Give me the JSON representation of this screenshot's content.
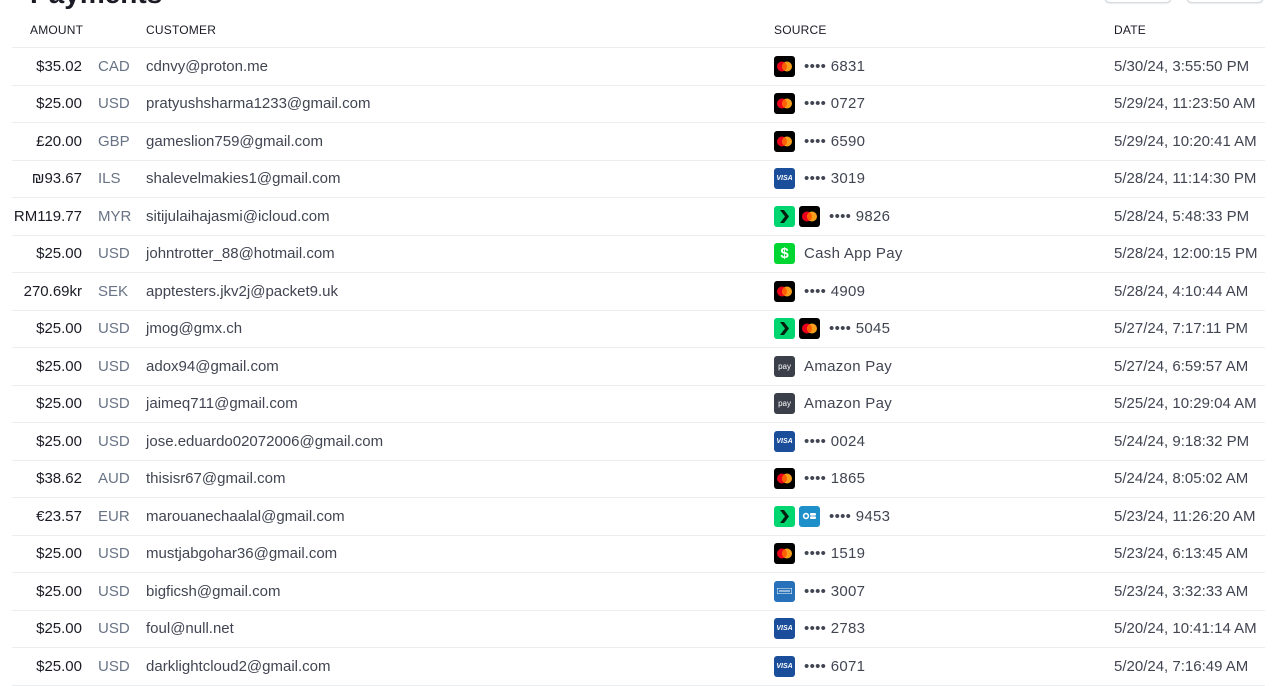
{
  "page": {
    "title": "Payments"
  },
  "table": {
    "columns": {
      "amount": "AMOUNT",
      "customer": "CUSTOMER",
      "source": "SOURCE",
      "date": "DATE"
    },
    "rows": [
      {
        "amount": "$35.02",
        "currency": "CAD",
        "customer": "cdnvy@proton.me",
        "icons": [
          "mastercard-icon"
        ],
        "source": "•••• 6831",
        "date": "5/30/24, 3:55:50 PM"
      },
      {
        "amount": "$25.00",
        "currency": "USD",
        "customer": "pratyushsharma1233@gmail.com",
        "icons": [
          "mastercard-icon"
        ],
        "source": "•••• 0727",
        "date": "5/29/24, 11:23:50 AM"
      },
      {
        "amount": "£20.00",
        "currency": "GBP",
        "customer": "gameslion759@gmail.com",
        "icons": [
          "mastercard-icon"
        ],
        "source": "•••• 6590",
        "date": "5/29/24, 10:20:41 AM"
      },
      {
        "amount": "₪93.67",
        "currency": "ILS",
        "customer": "shalevelmakies1@gmail.com",
        "icons": [
          "visa-icon"
        ],
        "source": "•••• 3019",
        "date": "5/28/24, 11:14:30 PM"
      },
      {
        "amount": "RM119.77",
        "currency": "MYR",
        "customer": "sitijulaihajasmi@icloud.com",
        "icons": [
          "link-icon",
          "mastercard-icon"
        ],
        "source": "•••• 9826",
        "date": "5/28/24, 5:48:33 PM"
      },
      {
        "amount": "$25.00",
        "currency": "USD",
        "customer": "johntrotter_88@hotmail.com",
        "icons": [
          "cash-app-icon"
        ],
        "source": "Cash App Pay",
        "date": "5/28/24, 12:00:15 PM"
      },
      {
        "amount": "270.69kr",
        "currency": "SEK",
        "customer": "apptesters.jkv2j@packet9.uk",
        "icons": [
          "mastercard-icon"
        ],
        "source": "•••• 4909",
        "date": "5/28/24, 4:10:44 AM"
      },
      {
        "amount": "$25.00",
        "currency": "USD",
        "customer": "jmog@gmx.ch",
        "icons": [
          "link-icon",
          "mastercard-icon"
        ],
        "source": "•••• 5045",
        "date": "5/27/24, 7:17:11 PM"
      },
      {
        "amount": "$25.00",
        "currency": "USD",
        "customer": "adox94@gmail.com",
        "icons": [
          "amazon-pay-icon"
        ],
        "source": "Amazon Pay",
        "date": "5/27/24, 6:59:57 AM"
      },
      {
        "amount": "$25.00",
        "currency": "USD",
        "customer": "jaimeq711@gmail.com",
        "icons": [
          "amazon-pay-icon"
        ],
        "source": "Amazon Pay",
        "date": "5/25/24, 10:29:04 AM"
      },
      {
        "amount": "$25.00",
        "currency": "USD",
        "customer": "jose.eduardo02072006@gmail.com",
        "icons": [
          "visa-icon"
        ],
        "source": "•••• 0024",
        "date": "5/24/24, 9:18:32 PM"
      },
      {
        "amount": "$38.62",
        "currency": "AUD",
        "customer": "thisisr67@gmail.com",
        "icons": [
          "mastercard-icon"
        ],
        "source": "•••• 1865",
        "date": "5/24/24, 8:05:02 AM"
      },
      {
        "amount": "€23.57",
        "currency": "EUR",
        "customer": "marouanechaalal@gmail.com",
        "icons": [
          "link-icon",
          "cartes-bancaires-icon"
        ],
        "source": "•••• 9453",
        "date": "5/23/24, 11:26:20 AM"
      },
      {
        "amount": "$25.00",
        "currency": "USD",
        "customer": "mustjabgohar36@gmail.com",
        "icons": [
          "mastercard-icon"
        ],
        "source": "•••• 1519",
        "date": "5/23/24, 6:13:45 AM"
      },
      {
        "amount": "$25.00",
        "currency": "USD",
        "customer": "bigficsh@gmail.com",
        "icons": [
          "amex-icon"
        ],
        "source": "•••• 3007",
        "date": "5/23/24, 3:32:33 AM"
      },
      {
        "amount": "$25.00",
        "currency": "USD",
        "customer": "foul@null.net",
        "icons": [
          "visa-icon"
        ],
        "source": "•••• 2783",
        "date": "5/20/24, 10:41:14 AM"
      },
      {
        "amount": "$25.00",
        "currency": "USD",
        "customer": "darklightcloud2@gmail.com",
        "icons": [
          "visa-icon"
        ],
        "source": "•••• 6071",
        "date": "5/20/24, 7:16:49 AM"
      }
    ]
  },
  "icon_labels": {
    "visa": "VISA",
    "cash_app": "$",
    "amazon_pay": "pay"
  },
  "colors": {
    "mastercard_bg": "#000000",
    "visa_bg": "#1a4e9a",
    "link_green": "#00d66f",
    "cash_app_green": "#00d632",
    "amazon_bg": "#3a3f4a",
    "amex_blue": "#2671b9",
    "cb_blue": "#1d8fc9"
  }
}
